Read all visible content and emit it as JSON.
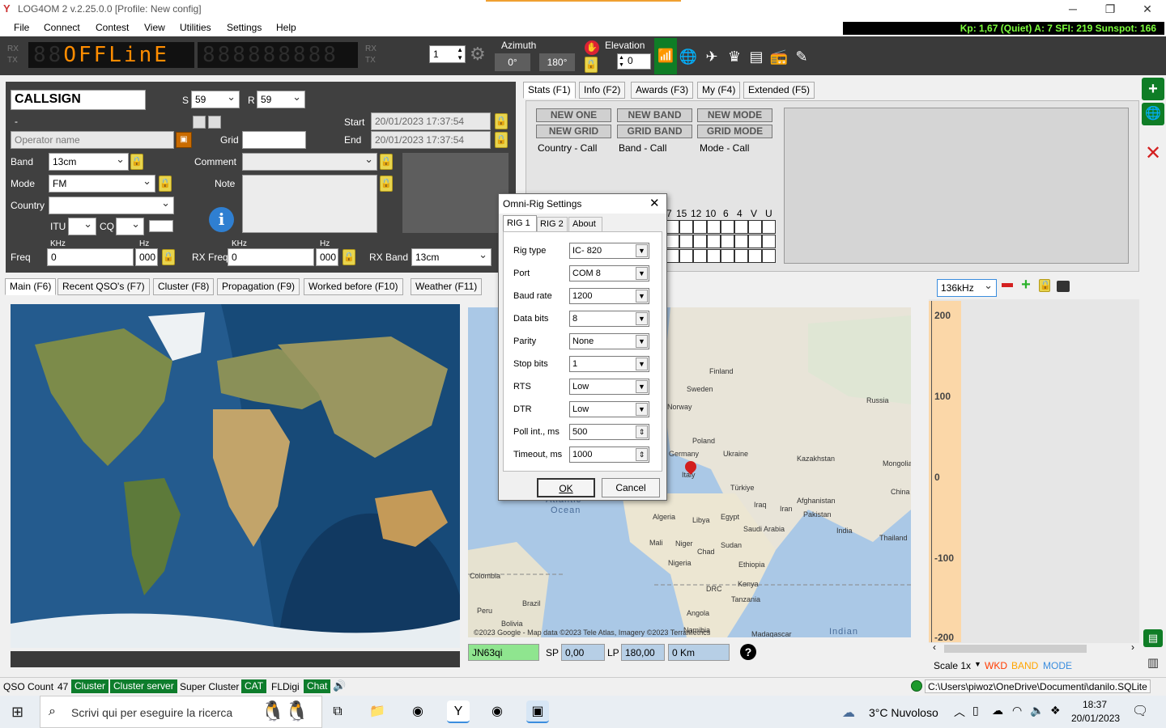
{
  "window": {
    "title": "LOG4OM 2 v.2.25.0.0 [Profile: New config]",
    "logo": "Y",
    "controls": [
      "─",
      "❐",
      "✕"
    ]
  },
  "menu": [
    "File",
    "Connect",
    "Contest",
    "View",
    "Utilities",
    "Settings",
    "Help"
  ],
  "space_weather": "Kp: 1,67 (Quiet)  A: 7  SFI: 219 Sunspot: 166",
  "toolbar": {
    "rx": "RX",
    "tx": "TX",
    "display_text": "OFFLinE",
    "display_dim": "88",
    "freq_dim": "888888888",
    "rig_number": "1",
    "azimuth_label": "Azimuth",
    "az_short": "0°",
    "az_long": "180°",
    "elevation_label": "Elevation",
    "elevation_value": "0"
  },
  "qso": {
    "callsign": "CALLSIGN",
    "s_label": "S",
    "s_value": "59",
    "r_label": "R",
    "r_value": "59",
    "dash": "-",
    "operator_placeholder": "Operator name",
    "grid_label": "Grid",
    "start_label": "Start",
    "start_value": "20/01/2023 17:37:54",
    "end_label": "End",
    "end_value": "20/01/2023 17:37:54",
    "band_label": "Band",
    "band_value": "13cm",
    "mode_label": "Mode",
    "mode_value": "FM",
    "country_label": "Country",
    "comment_label": "Comment",
    "note_label": "Note",
    "itu_label": "ITU",
    "cq_label": "CQ",
    "khz": "KHz",
    "hz": "Hz",
    "freq_label": "Freq",
    "freq_value": "0",
    "freq_hz": "000",
    "rxfreq_label": "RX Freq",
    "rxfreq_value": "0",
    "rxfreq_hz": "000",
    "rxband_label": "RX Band",
    "rxband_value": "13cm"
  },
  "stats_tabs": [
    "Stats (F1)",
    "Info (F2)",
    "Awards (F3)",
    "My (F4)",
    "Extended (F5)"
  ],
  "stats": {
    "badges": [
      "NEW ONE",
      "NEW BAND",
      "NEW MODE",
      "NEW GRID",
      "GRID BAND",
      "GRID MODE"
    ],
    "captions": [
      "Country - Call",
      "Band - Call",
      "Mode - Call"
    ],
    "band_headers": [
      "7",
      "15",
      "12",
      "10",
      "6",
      "4",
      "V",
      "U"
    ]
  },
  "main_tabs": [
    "Main (F6)",
    "Recent QSO's (F7)",
    "Cluster (F8)",
    "Propagation (F9)",
    "Worked before (F10)",
    "Weather (F11)"
  ],
  "map": {
    "countries": [
      "Finland",
      "Sweden",
      "Norway",
      "Russia",
      "Poland",
      "Germany",
      "Ukraine",
      "Kazakhstan",
      "Mongolia",
      "Italy",
      "Türkiye",
      "China",
      "Afghanistan",
      "Iraq",
      "Iran",
      "Pakistan",
      "Algeria",
      "Libya",
      "Egypt",
      "Saudi Arabia",
      "India",
      "Thailand",
      "Mali",
      "Niger",
      "Chad",
      "Sudan",
      "Ethiopia",
      "Nigeria",
      "Kenya",
      "DRC",
      "Tanzania",
      "Angola",
      "Colombia",
      "Peru",
      "Brazil",
      "Bolivia",
      "Namibia",
      "Madagascar",
      "Indian",
      "Atlantic",
      "Ocean"
    ],
    "attribution": "©2023 Google - Map data ©2023 Tele Atlas, Imagery ©2023 TerraMetrics",
    "locator": "JN63qi",
    "sp_label": "SP",
    "sp_value": "0,00",
    "lp_label": "LP",
    "lp_value": "180,00",
    "distance": "0 Km"
  },
  "scale": {
    "band_select": "136kHz",
    "ticks": [
      "200",
      "100",
      "0",
      "-100",
      "-200"
    ],
    "scale_label": "Scale 1x",
    "wkd": "WKD",
    "band": "BAND",
    "mode": "MODE",
    "colors": {
      "wkd": "#ff3b00",
      "band": "#ffa500",
      "mode": "#3a8dde"
    }
  },
  "dialog": {
    "title": "Omni-Rig Settings",
    "tabs": [
      "RIG 1",
      "RIG 2",
      "About"
    ],
    "fields": [
      {
        "label": "Rig type",
        "value": "IC- 820",
        "kind": "drop"
      },
      {
        "label": "Port",
        "value": "COM 8",
        "kind": "drop"
      },
      {
        "label": "Baud rate",
        "value": "1200",
        "kind": "drop"
      },
      {
        "label": "Data bits",
        "value": "8",
        "kind": "drop"
      },
      {
        "label": "Parity",
        "value": "None",
        "kind": "drop"
      },
      {
        "label": "Stop bits",
        "value": "1",
        "kind": "drop"
      },
      {
        "label": "RTS",
        "value": "Low",
        "kind": "drop"
      },
      {
        "label": "DTR",
        "value": "Low",
        "kind": "drop"
      },
      {
        "label": "Poll int., ms",
        "value": "500",
        "kind": "spin"
      },
      {
        "label": "Timeout, ms",
        "value": "1000",
        "kind": "spin"
      }
    ],
    "ok": "OK",
    "cancel": "Cancel"
  },
  "status": {
    "qso_count_label": "QSO Count",
    "qso_count": "47",
    "badges": [
      "Cluster",
      "Cluster server"
    ],
    "plain": [
      "Super Cluster"
    ],
    "cat": "CAT",
    "fldigi": "FLDigi",
    "chat": "Chat",
    "db_path": "C:\\Users\\piwoz\\OneDrive\\Documenti\\danilo.SQLite"
  },
  "taskbar": {
    "search_placeholder": "Scrivi qui per eseguire la ricerca",
    "weather": "3°C  Nuvoloso",
    "time": "18:37",
    "date": "20/01/2023"
  }
}
